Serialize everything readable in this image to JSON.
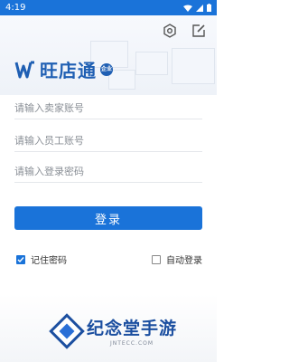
{
  "status_bar": {
    "time": "4:19"
  },
  "header": {
    "icons": [
      "settings-icon",
      "edit-icon"
    ]
  },
  "logo": {
    "text": "旺店通",
    "badge": "企业"
  },
  "form": {
    "seller_account_placeholder": "请输入卖家账号",
    "employee_account_placeholder": "请输入员工账号",
    "password_placeholder": "请输入登录密码",
    "login_label": "登录"
  },
  "options": {
    "remember_password_label": "记住密码",
    "remember_password_checked": true,
    "auto_login_label": "自动登录",
    "auto_login_checked": false
  },
  "watermark": {
    "title": "纪念堂手游",
    "subtitle": "JNTECC.COM"
  },
  "colors": {
    "primary": "#1a73d9",
    "logo": "#1f5fb3",
    "watermark": "#1c4fa0"
  }
}
